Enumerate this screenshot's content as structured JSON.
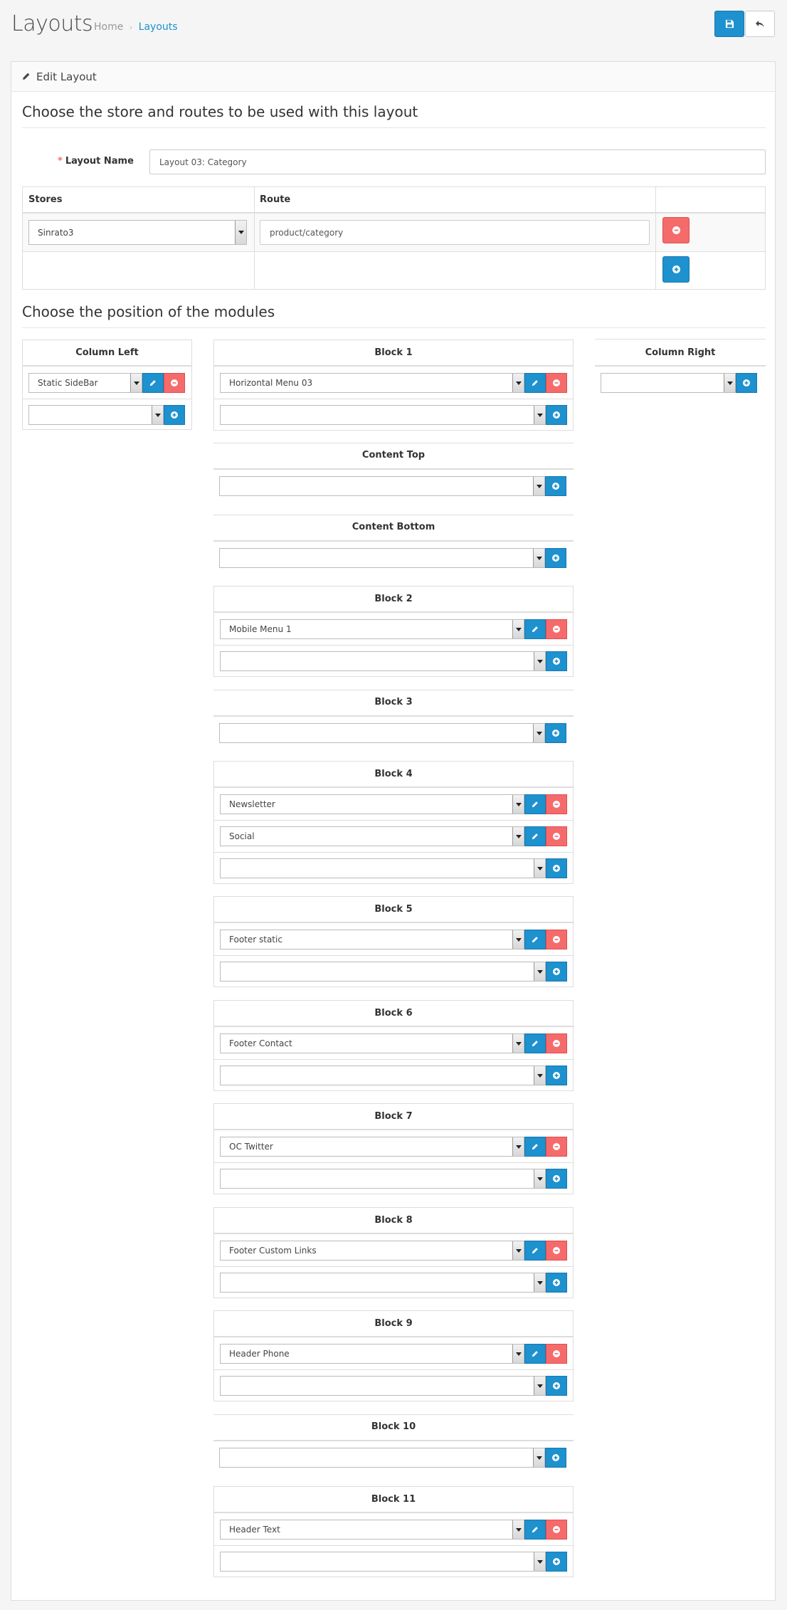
{
  "header": {
    "title": "Layouts",
    "breadcrumb": [
      {
        "label": "Home"
      },
      {
        "label": "Layouts"
      }
    ],
    "breadcrumb_separator": "›"
  },
  "panel": {
    "heading": "Edit Layout",
    "legend_routes": "Choose the store and routes to be used with this layout",
    "legend_modules": "Choose the position of the modules"
  },
  "form": {
    "layout_name_label": "Layout Name",
    "layout_name_value": "Layout 03: Category",
    "stores_header": "Stores",
    "route_header": "Route",
    "store_value": "Sinrato3",
    "route_value": "product/category"
  },
  "positions": {
    "column_left": {
      "title": "Column Left",
      "modules": [
        "Static SideBar"
      ]
    },
    "column_right": {
      "title": "Column Right",
      "modules": []
    },
    "block1": {
      "title": "Block 1",
      "modules": [
        "Horizontal Menu 03"
      ]
    },
    "content_top": {
      "title": "Content Top",
      "modules": []
    },
    "content_bottom": {
      "title": "Content Bottom",
      "modules": []
    },
    "block2": {
      "title": "Block 2",
      "modules": [
        "Mobile Menu 1"
      ]
    },
    "block3": {
      "title": "Block 3",
      "modules": []
    },
    "block4": {
      "title": "Block 4",
      "modules": [
        "Newsletter",
        "Social"
      ]
    },
    "block5": {
      "title": "Block 5",
      "modules": [
        "Footer static"
      ]
    },
    "block6": {
      "title": "Block 6",
      "modules": [
        "Footer Contact"
      ]
    },
    "block7": {
      "title": "Block 7",
      "modules": [
        "OC Twitter"
      ]
    },
    "block8": {
      "title": "Block 8",
      "modules": [
        "Footer Custom Links"
      ]
    },
    "block9": {
      "title": "Block 9",
      "modules": [
        "Header Phone"
      ]
    },
    "block10": {
      "title": "Block 10",
      "modules": []
    },
    "block11": {
      "title": "Block 11",
      "modules": [
        "Header Text"
      ]
    }
  },
  "colors": {
    "primary": "#1e91cf",
    "danger": "#f56b6b"
  },
  "icons": {
    "save": "floppy-disk-icon",
    "back": "reply-icon",
    "heading": "pencil-icon",
    "edit": "pencil-icon",
    "remove": "minus-circle-icon",
    "add": "plus-circle-icon"
  }
}
